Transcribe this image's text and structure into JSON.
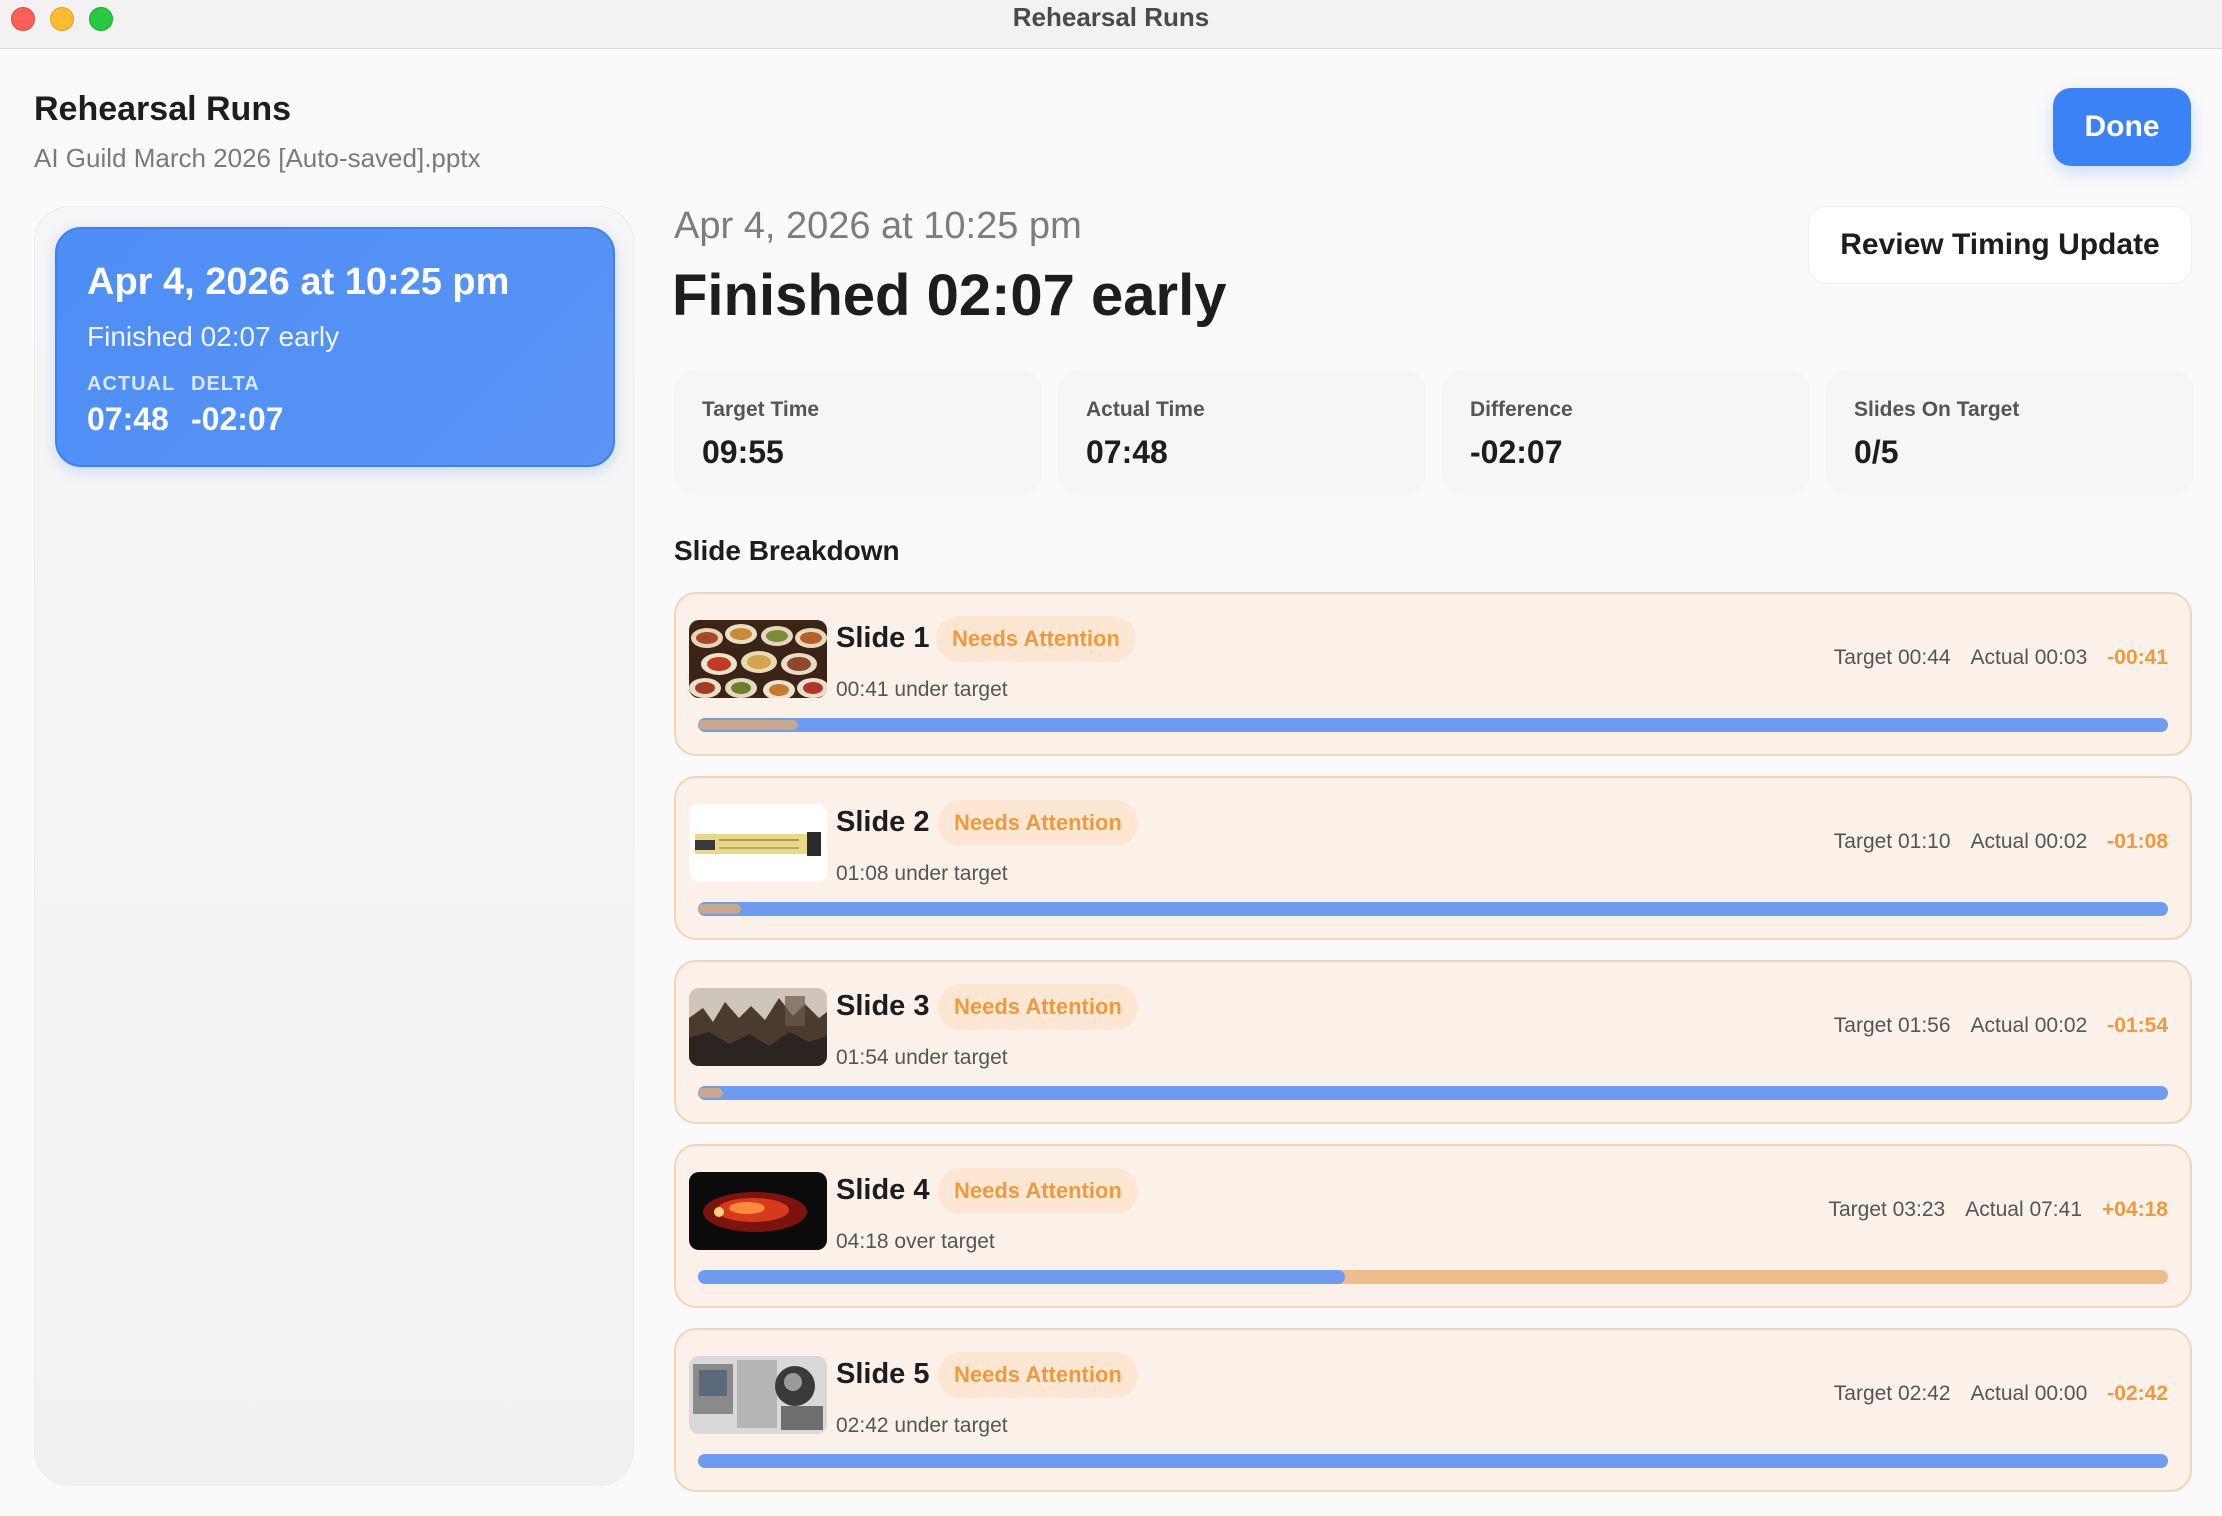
{
  "window": {
    "title": "Rehearsal Runs"
  },
  "header": {
    "title": "Rehearsal Runs",
    "subtitle": "AI Guild March 2026 [Auto-saved].pptx",
    "done_label": "Done"
  },
  "sidebar": {
    "runs": [
      {
        "date": "Apr 4, 2026 at 10:25 pm",
        "status": "Finished 02:07 early",
        "actual_label": "ACTUAL",
        "actual_value": "07:48",
        "delta_label": "DELTA",
        "delta_value": "-02:07"
      }
    ]
  },
  "main": {
    "date": "Apr 4, 2026 at 10:25 pm",
    "status": "Finished 02:07 early",
    "review_label": "Review Timing Update",
    "stats": [
      {
        "label": "Target Time",
        "value": "09:55"
      },
      {
        "label": "Actual Time",
        "value": "07:48"
      },
      {
        "label": "Difference",
        "value": "-02:07"
      },
      {
        "label": "Slides On Target",
        "value": "0/5"
      }
    ],
    "breakdown_title": "Slide Breakdown",
    "slides": [
      {
        "name": "Slide 1",
        "badge": "Needs Attention",
        "sub": "00:41 under target",
        "target": "Target 00:44",
        "actual": "Actual 00:03",
        "delta": "-00:41",
        "progress": 0.068,
        "over": false,
        "thumb": "food-photo"
      },
      {
        "name": "Slide 2",
        "badge": "Needs Attention",
        "sub": "01:08 under target",
        "target": "Target 01:10",
        "actual": "Actual 00:02",
        "delta": "-01:08",
        "progress": 0.029,
        "over": false,
        "thumb": "timeline-graphic"
      },
      {
        "name": "Slide 3",
        "badge": "Needs Attention",
        "sub": "01:54 under target",
        "target": "Target 01:56",
        "actual": "Actual 00:02",
        "delta": "-01:54",
        "progress": 0.017,
        "over": false,
        "thumb": "historic-photo"
      },
      {
        "name": "Slide 4",
        "badge": "Needs Attention",
        "sub": "04:18 over target",
        "target": "Target 03:23",
        "actual": "Actual 07:41",
        "delta": "+04:18",
        "progress": 0.44,
        "over": true,
        "thumb": "openclaw-logo"
      },
      {
        "name": "Slide 5",
        "badge": "Needs Attention",
        "sub": "02:42 under target",
        "target": "Target 02:42",
        "actual": "Actual 00:00",
        "delta": "-02:42",
        "progress": 0.0,
        "over": false,
        "thumb": "collage-photo"
      }
    ]
  },
  "colors": {
    "accent": "#3b82f6",
    "warning": "#ee9a3f",
    "card_bg": "#fbf1e8"
  }
}
